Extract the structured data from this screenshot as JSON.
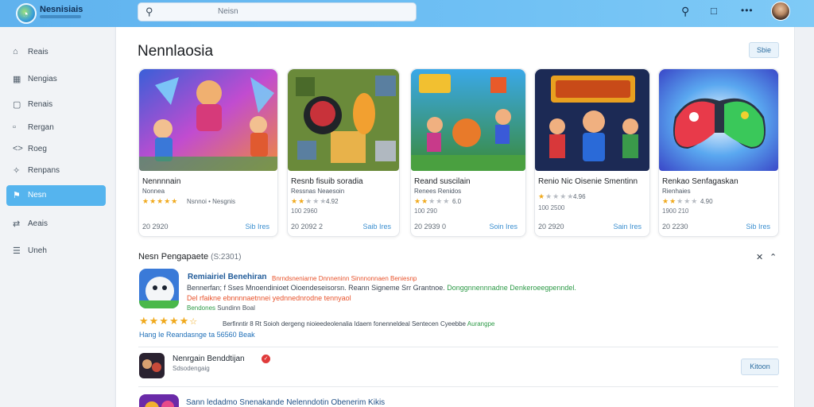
{
  "header": {
    "brand": "Nesnisiais",
    "search_placeholder": "Neisn",
    "icons": [
      "search-icon",
      "chat-icon",
      "more-icon"
    ]
  },
  "sidebar": {
    "items": [
      {
        "label": "Reais",
        "icon": "home-icon"
      },
      {
        "label": "Nengias",
        "icon": "grid-icon"
      },
      {
        "label": "Renais",
        "icon": "store-icon"
      },
      {
        "label": "Rergan",
        "icon": "chat-icon"
      },
      {
        "label": "Roeg",
        "icon": "code-icon"
      },
      {
        "label": "Renpans",
        "icon": "puzzle-icon"
      },
      {
        "label": "Nesn",
        "icon": "flag-icon",
        "active": true
      },
      {
        "label": "Aeais",
        "icon": "flow-icon"
      },
      {
        "label": "Uneh",
        "icon": "menu-icon"
      }
    ]
  },
  "main": {
    "title": "Nennlaosia",
    "top_button": "Sbie",
    "cards": [
      {
        "title": "Nennnnain",
        "subtitle": "Nonnea",
        "rating": "5.0",
        "stars": 5,
        "sub2": "Nsnnoi • Nesgnis",
        "count": "20 2920",
        "link": "Sib Ires"
      },
      {
        "title": "Resnb fisuib soradia",
        "subtitle": "Ressnas Neaesoin",
        "rating": "4.92",
        "stars": 2,
        "sub2": "100 2960",
        "count": "20 2092 2",
        "link": "Saib Ires"
      },
      {
        "title": "Reand suscilain",
        "subtitle": "Renees Renidos",
        "rating": "6.0",
        "stars": 2,
        "sub2": "100 290",
        "count": "20 2939 0",
        "link": "Soin Ires"
      },
      {
        "title": "Renio Nic Oisenie Smentinn",
        "subtitle": "",
        "rating": "4.96",
        "stars": 1,
        "sub2": "100 2500",
        "count": "20 2920",
        "link": "Sain Ires"
      },
      {
        "title": "Renkao Senfagaskan",
        "subtitle": "Rienhaies",
        "rating": "4.90",
        "stars": 2,
        "sub2": "1900 210",
        "count": "20 2230",
        "link": "Sib Ires"
      }
    ],
    "section": {
      "title": "Nesn Pengapaete",
      "count": "(S:2301)"
    },
    "featured": {
      "title": "Remiairiel Benehiran",
      "tag": "Bnrndsneniarne Dnnneninn Sinnnonnaen Beniesnp",
      "desc": "Bennerfan; f Sses Mnoendinioet Oioendeseisorsn.",
      "desc2": "Reann Signeme Srr Grantnoe.",
      "desc3": "Donggnnennnadne Denkeroeegpenndel.",
      "warn": "Del rfaikne ebnnnnaetnnei yednnednrodne tennyaol",
      "cat_label": "Bendones",
      "cat": "Sundinn Boal",
      "stars": 5.5,
      "note": "Berfinntir 8 Rt Soioh dergeng nioieedeolenalia Idaem fonenneldeal Sentecen Cyeebbe",
      "note_tag": "Aurangpe",
      "link": "Hang Ie Reandasnge ta 56560 Beak"
    },
    "list_item": {
      "title": "Nenrgain Benddtijan",
      "subtitle": "Sdsodengaig",
      "button": "Kitoon"
    },
    "list_item2": {
      "title": "Sann ledadmo Snenakande Nelenndotin Obenerim Kikis"
    }
  }
}
